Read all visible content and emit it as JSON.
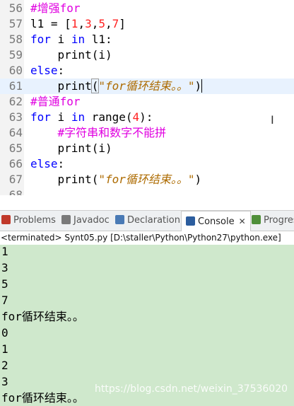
{
  "editor": {
    "lines": [
      {
        "num": "56",
        "tokens": [
          {
            "t": "#增强for",
            "c": "comment"
          }
        ]
      },
      {
        "num": "57",
        "tokens": [
          {
            "t": "l1 = [",
            "c": ""
          },
          {
            "t": "1",
            "c": "num"
          },
          {
            "t": ",",
            "c": ""
          },
          {
            "t": "3",
            "c": "num"
          },
          {
            "t": ",",
            "c": ""
          },
          {
            "t": "5",
            "c": "num"
          },
          {
            "t": ",",
            "c": ""
          },
          {
            "t": "7",
            "c": "num"
          },
          {
            "t": "]",
            "c": ""
          }
        ]
      },
      {
        "num": "58",
        "tokens": [
          {
            "t": "for",
            "c": "kw"
          },
          {
            "t": " i ",
            "c": ""
          },
          {
            "t": "in",
            "c": "kw"
          },
          {
            "t": " l1:",
            "c": ""
          }
        ]
      },
      {
        "num": "59",
        "tokens": [
          {
            "t": "    print(i)",
            "c": ""
          }
        ]
      },
      {
        "num": "60",
        "tokens": [
          {
            "t": "else",
            "c": "kw"
          },
          {
            "t": ":",
            "c": ""
          }
        ]
      },
      {
        "num": "61",
        "current": true,
        "tokens": [
          {
            "t": "    print",
            "c": ""
          },
          {
            "t": "(",
            "c": "brace-box"
          },
          {
            "t": "\"for循环结束。。\"",
            "c": "str"
          },
          {
            "t": ")",
            "c": "caret"
          }
        ]
      },
      {
        "num": "62",
        "tokens": [
          {
            "t": "#普通for",
            "c": "comment"
          }
        ]
      },
      {
        "num": "63",
        "tokens": [
          {
            "t": "for",
            "c": "kw"
          },
          {
            "t": " i ",
            "c": ""
          },
          {
            "t": "in",
            "c": "kw"
          },
          {
            "t": " range(",
            "c": ""
          },
          {
            "t": "4",
            "c": "num"
          },
          {
            "t": "):",
            "c": ""
          }
        ]
      },
      {
        "num": "64",
        "tokens": [
          {
            "t": "    #字符串和数字不能拼",
            "c": "comment"
          }
        ]
      },
      {
        "num": "65",
        "tokens": [
          {
            "t": "    print(i)",
            "c": ""
          }
        ]
      },
      {
        "num": "66",
        "tokens": [
          {
            "t": "else",
            "c": "kw"
          },
          {
            "t": ":",
            "c": ""
          }
        ]
      },
      {
        "num": "67",
        "tokens": [
          {
            "t": "    print(",
            "c": ""
          },
          {
            "t": "\"for循环结束。。\"",
            "c": "str"
          },
          {
            "t": ")",
            "c": ""
          }
        ]
      },
      {
        "num": "68",
        "tokens": []
      }
    ]
  },
  "tabs": [
    {
      "label": "Problems",
      "icon": "problems-icon",
      "color": "#c0392b",
      "active": false
    },
    {
      "label": "Javadoc",
      "icon": "javadoc-icon",
      "color": "#7a7a7a",
      "active": false
    },
    {
      "label": "Declaration",
      "icon": "declaration-icon",
      "color": "#4a7ab5",
      "active": false
    },
    {
      "label": "Console",
      "icon": "console-icon",
      "color": "#2c5d9e",
      "active": true
    },
    {
      "label": "Progres",
      "icon": "progress-icon",
      "color": "#4f8f3a",
      "active": false
    }
  ],
  "console": {
    "status": "<terminated> Synt05.py [D:\\staller\\Python\\Python27\\python.exe]",
    "output": [
      "1",
      "3",
      "5",
      "7",
      "for循环结束。。",
      "0",
      "1",
      "2",
      "3",
      "for循环结束。。"
    ]
  },
  "watermark": "https://blog.csdn.net/weixin_37536020"
}
